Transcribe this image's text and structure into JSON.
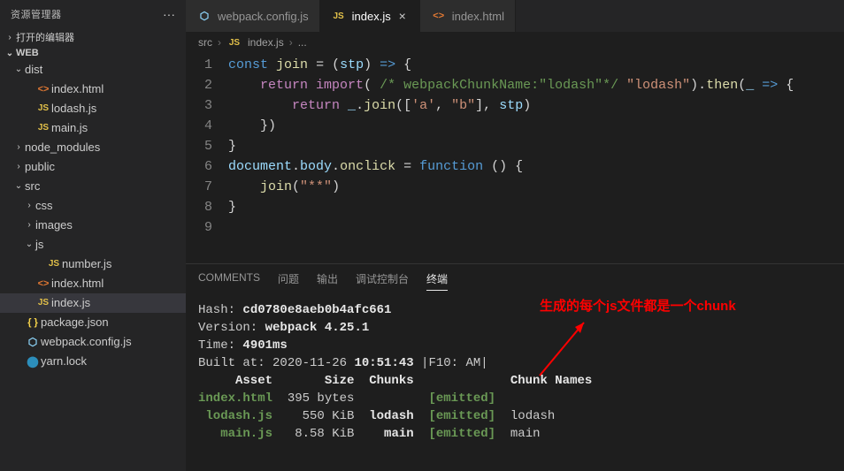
{
  "sidebar": {
    "title": "资源管理器",
    "open_editors": "打开的编辑器",
    "root": "WEB",
    "items": [
      {
        "type": "folder",
        "label": "dist",
        "depth": 1,
        "open": true,
        "chev": "⌄"
      },
      {
        "type": "file",
        "label": "index.html",
        "depth": 2,
        "icon": "html"
      },
      {
        "type": "file",
        "label": "lodash.js",
        "depth": 2,
        "icon": "js"
      },
      {
        "type": "file",
        "label": "main.js",
        "depth": 2,
        "icon": "js"
      },
      {
        "type": "folder",
        "label": "node_modules",
        "depth": 1,
        "open": false,
        "chev": "›"
      },
      {
        "type": "folder",
        "label": "public",
        "depth": 1,
        "open": false,
        "chev": "›"
      },
      {
        "type": "folder",
        "label": "src",
        "depth": 1,
        "open": true,
        "chev": "⌄"
      },
      {
        "type": "folder",
        "label": "css",
        "depth": 2,
        "open": false,
        "chev": "›"
      },
      {
        "type": "folder",
        "label": "images",
        "depth": 2,
        "open": false,
        "chev": "›"
      },
      {
        "type": "folder",
        "label": "js",
        "depth": 2,
        "open": true,
        "chev": "⌄"
      },
      {
        "type": "file",
        "label": "number.js",
        "depth": 3,
        "icon": "js"
      },
      {
        "type": "file",
        "label": "index.html",
        "depth": 2,
        "icon": "html"
      },
      {
        "type": "file",
        "label": "index.js",
        "depth": 2,
        "icon": "js",
        "selected": true
      },
      {
        "type": "file",
        "label": "package.json",
        "depth": 1,
        "icon": "json"
      },
      {
        "type": "file",
        "label": "webpack.config.js",
        "depth": 1,
        "icon": "webpack"
      },
      {
        "type": "file",
        "label": "yarn.lock",
        "depth": 1,
        "icon": "yarn"
      }
    ]
  },
  "tabs": [
    {
      "label": "webpack.config.js",
      "icon": "webpack",
      "active": false
    },
    {
      "label": "index.js",
      "icon": "js",
      "active": true
    },
    {
      "label": "index.html",
      "icon": "html",
      "active": false
    }
  ],
  "breadcrumbs": [
    "src",
    "index.js",
    "..."
  ],
  "code": {
    "lines": [
      {
        "n": 1,
        "html": "<span class='tok-kw'>const</span> <span class='tok-fn'>join</span> <span class='tok-punc'>= (</span><span class='tok-var'>stp</span><span class='tok-punc'>)</span> <span class='tok-kw'>=&gt;</span> <span class='tok-punc'>{</span>"
      },
      {
        "n": 2,
        "html": "    <span class='tok-kw2'>return</span> <span class='tok-kw2'>import</span><span class='tok-punc'>(</span> <span class='tok-cmt'>/* webpackChunkName:\"lodash\"*/</span> <span class='tok-str'>\"lodash\"</span><span class='tok-punc'>).</span><span class='tok-fn'>then</span><span class='tok-punc'>(</span><span class='tok-var'>_</span> <span class='tok-kw'>=&gt;</span> <span class='tok-punc'>{</span>"
      },
      {
        "n": 3,
        "html": "        <span class='tok-kw2'>return</span> <span class='tok-var'>_</span><span class='tok-punc'>.</span><span class='tok-fn'>join</span><span class='tok-punc'>([</span><span class='tok-str'>'a'</span><span class='tok-punc'>,</span> <span class='tok-str'>\"b\"</span><span class='tok-punc'>],</span> <span class='tok-var'>stp</span><span class='tok-punc'>)</span>"
      },
      {
        "n": 4,
        "html": "    <span class='tok-punc'>})</span>"
      },
      {
        "n": 5,
        "html": "<span class='tok-punc'>}</span>"
      },
      {
        "n": 6,
        "html": "<span class='tok-var'>document</span><span class='tok-punc'>.</span><span class='tok-var'>body</span><span class='tok-punc'>.</span><span class='tok-fn'>onclick</span> <span class='tok-punc'>=</span> <span class='tok-kw'>function</span> <span class='tok-punc'>() {</span>"
      },
      {
        "n": 7,
        "html": "    <span class='tok-fn'>join</span><span class='tok-punc'>(</span><span class='tok-str'>\"**\"</span><span class='tok-punc'>)</span>"
      },
      {
        "n": 8,
        "html": "<span class='tok-punc'>}</span>"
      },
      {
        "n": 9,
        "html": ""
      }
    ]
  },
  "panel": {
    "tabs": [
      "COMMENTS",
      "问题",
      "输出",
      "调试控制台",
      "终端"
    ],
    "active": 4,
    "annotation": "生成的每个js文件都是一个chunk",
    "terminal": {
      "hash_label": "Hash: ",
      "hash": "cd0780e8aeb0b4afc661",
      "version_label": "Version: ",
      "version": "webpack 4.25.1",
      "time_label": "Time: ",
      "time": "4901ms",
      "built_label": "Built at: ",
      "built_date": "2020-11-26 ",
      "built_time": "10:51:43",
      "built_suffix": " |F10: AM|",
      "header": "     Asset       Size  Chunks             Chunk Names",
      "rows": [
        {
          "asset": "index.html",
          "size": "395 bytes",
          "chunks": "",
          "status": "[emitted]",
          "name": ""
        },
        {
          "asset": " lodash.js",
          "size": "  550 KiB",
          "chunks": "lodash",
          "status": "[emitted]",
          "name": "lodash"
        },
        {
          "asset": "   main.js",
          "size": " 8.58 KiB",
          "chunks": "  main",
          "status": "[emitted]",
          "name": "main"
        }
      ]
    }
  },
  "icons": {
    "js": "JS",
    "html": "<>",
    "json": "{ }",
    "webpack": "⬡",
    "yarn": "⬤"
  }
}
